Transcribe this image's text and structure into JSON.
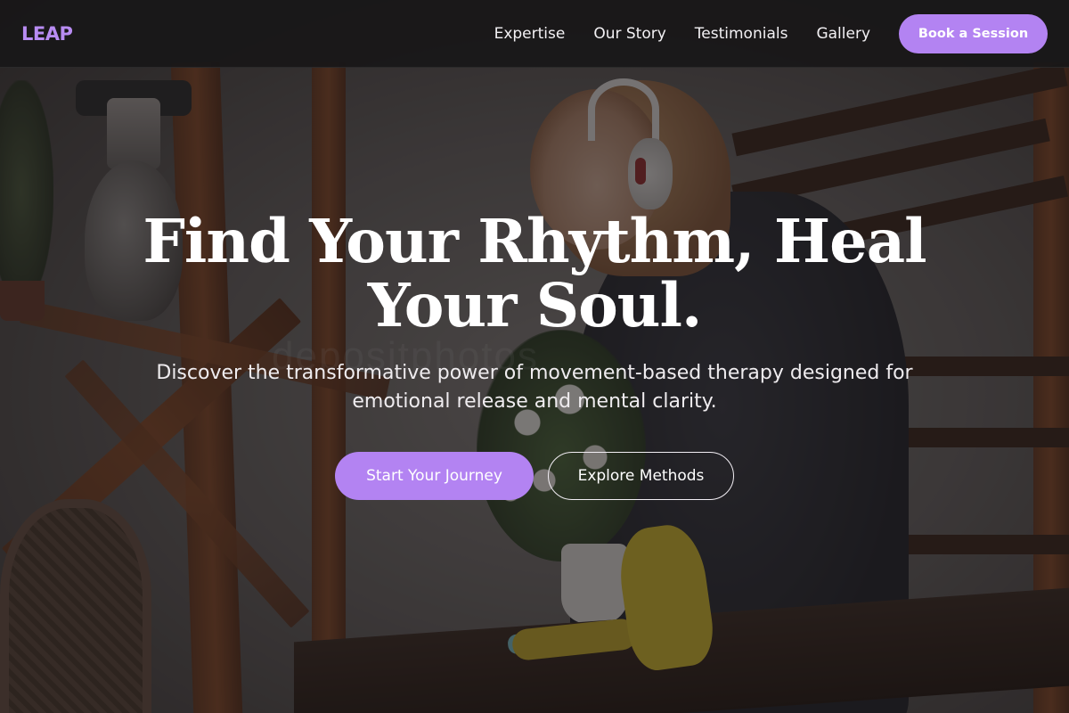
{
  "brand": {
    "logo": "LEAP",
    "accent_color": "#b383f2"
  },
  "nav": {
    "links": [
      "Expertise",
      "Our Story",
      "Testimonials",
      "Gallery"
    ],
    "cta_label": "Book a Session"
  },
  "hero": {
    "title": "Find Your Rhythm, Heal Your Soul.",
    "subtitle": "Discover the transformative power of movement-based therapy designed for emotional release and mental clarity.",
    "primary_cta": "Start Your Journey",
    "secondary_cta": "Explore Methods"
  },
  "background": {
    "watermark_text": "depositphotos"
  }
}
